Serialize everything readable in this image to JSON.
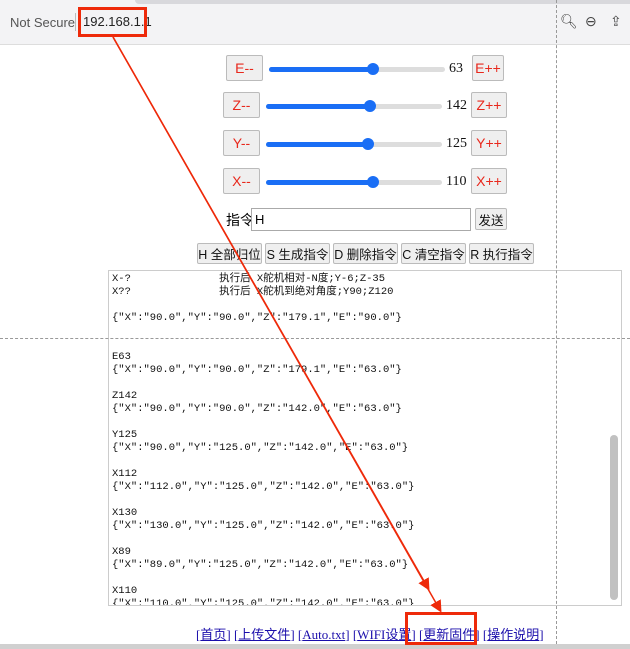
{
  "browser": {
    "security_label": "Not Secure",
    "url": "192.168.1.1",
    "icons": [
      "search-icon",
      "zoom-out-icon",
      "share-icon"
    ]
  },
  "sliders": [
    {
      "minus": "E--",
      "plus": "E++",
      "value": "63",
      "fraction": 0.59
    },
    {
      "minus": "Z--",
      "plus": "Z++",
      "value": "142",
      "fraction": 0.59
    },
    {
      "minus": "Y--",
      "plus": "Y++",
      "value": "125",
      "fraction": 0.58
    },
    {
      "minus": "X--",
      "plus": "X++",
      "value": "110",
      "fraction": 0.61
    }
  ],
  "command": {
    "label": "指令",
    "value": "H",
    "send": "发送"
  },
  "actions": [
    "H 全部归位",
    "S 生成指令",
    "D 删除指令",
    "C 清空指令",
    "R 执行指令"
  ],
  "log": "X-?              执行后 X舵机相对-N度;Y-6;Z-35\nX??              执行后 X舵机到绝对角度;Y90;Z120\n\n{\"X\":\"90.0\",\"Y\":\"90.0\",\"Z\":\"179.1\",\"E\":\"90.0\"}\n\n\nE63\n{\"X\":\"90.0\",\"Y\":\"90.0\",\"Z\":\"179.1\",\"E\":\"63.0\"}\n\nZ142\n{\"X\":\"90.0\",\"Y\":\"90.0\",\"Z\":\"142.0\",\"E\":\"63.0\"}\n\nY125\n{\"X\":\"90.0\",\"Y\":\"125.0\",\"Z\":\"142.0\",\"E\":\"63.0\"}\n\nX112\n{\"X\":\"112.0\",\"Y\":\"125.0\",\"Z\":\"142.0\",\"E\":\"63.0\"}\n\nX130\n{\"X\":\"130.0\",\"Y\":\"125.0\",\"Z\":\"142.0\",\"E\":\"63.0\"}\n\nX89\n{\"X\":\"89.0\",\"Y\":\"125.0\",\"Z\":\"142.0\",\"E\":\"63.0\"}\n\nX110\n{\"X\":\"110.0\",\"Y\":\"125.0\",\"Z\":\"142.0\",\"E\":\"63.0\"}",
  "links": [
    "首页",
    "上传文件",
    "Auto.txt",
    "WIFI设置",
    "更新固件",
    "操作说明"
  ],
  "annotation_color": "#ee2a0a"
}
